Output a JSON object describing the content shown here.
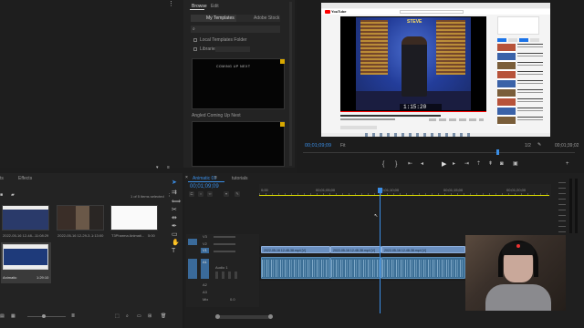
{
  "browser": {
    "tabs": [
      "Browse",
      "Edit"
    ],
    "subtabs": [
      "My Templates",
      "Adobe Stock"
    ],
    "options": [
      "Local Templates Folder",
      "Libraries"
    ],
    "templates": [
      {
        "name": "Angled Coming Up Next",
        "thumb_text": "COMING UP NEXT"
      },
      {
        "name": ""
      }
    ]
  },
  "program_monitor": {
    "timecode": "00;01;09;09",
    "fit": "Fit",
    "resolution": "1/2",
    "duration": "00;01;39;02",
    "video_overlay": "STEVE",
    "video_timecode": "1:15:20",
    "youtube_logo": "YouTube",
    "sidebar_tabs": [
      "All",
      "From the series",
      "Related"
    ]
  },
  "project_panel": {
    "tab": "Effects",
    "prev_tab": "ts",
    "count": "1 of 5 items selected",
    "items": [
      {
        "name": "2022-05-16 12-48-...",
        "dur": "11:08:29"
      },
      {
        "name": "2022-05-16 12-29-3...",
        "dur": "1:13:00"
      },
      {
        "name": "T3Pharma Animati...",
        "dur": "5:00"
      },
      {
        "name": "Animatic",
        "dur": "1:29:10"
      }
    ]
  },
  "timeline": {
    "tabs": [
      "Animatic 01",
      "tutorials"
    ],
    "timecode": "00;01;09;09",
    "ruler": [
      "0;00",
      "00;01;05;00",
      "00;01;10;00",
      "00;01;15;00",
      "00;01;20;00"
    ],
    "tracks": [
      "V3",
      "V2",
      "V1",
      "A1",
      "A2",
      "A3"
    ],
    "track_name": "Audio 1",
    "master": "Mix",
    "master_val": "0.0",
    "clips": [
      "2022-05-16 12-48-38.mp4 [V]",
      "2022-05-16 12-48-38.mp4 [V]",
      "2022-05-16 12-48-38.mp4 [V]"
    ]
  },
  "colors": {
    "accent": "#2d8ceb",
    "playhead": "#3a8ee6",
    "work_area": "#d8d800",
    "video_clip": "#6a8fbf",
    "audio_clip": "#3c6f96"
  }
}
